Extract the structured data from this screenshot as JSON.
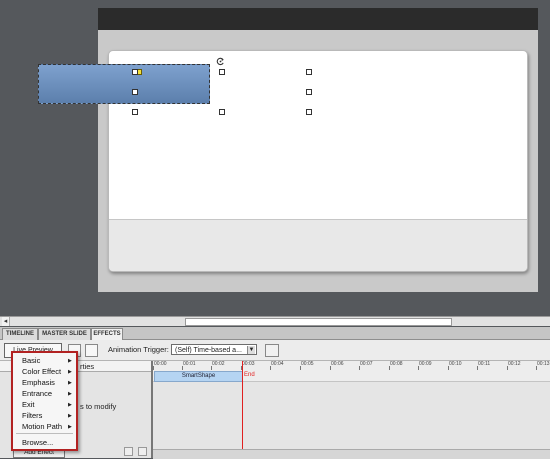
{
  "tabs": [
    {
      "label": "TIMELINE"
    },
    {
      "label": "MASTER SLIDE"
    },
    {
      "label": "EFFECTS"
    }
  ],
  "toolbar": {
    "trigger_label": "Animation Trigger:",
    "trigger_value": "(Self) Time-based a..."
  },
  "add_effect_label": "Live Preview",
  "add_effect_bottom_label": "Add Effect",
  "properties_header": "rties",
  "modify_hint": "s to modify",
  "menu": {
    "items": [
      {
        "label": "Basic",
        "submenu": true
      },
      {
        "label": "Color Effect",
        "submenu": true
      },
      {
        "label": "Emphasis",
        "submenu": true
      },
      {
        "label": "Entrance",
        "submenu": true
      },
      {
        "label": "Exit",
        "submenu": true
      },
      {
        "label": "Filters",
        "submenu": true
      },
      {
        "label": "Motion Path",
        "submenu": true
      }
    ],
    "browse_label": "Browse..."
  },
  "timeline": {
    "ticks": [
      "00:00",
      "00:01",
      "00:02",
      "00:03",
      "00:04",
      "00:05",
      "00:06",
      "00:07",
      "00:08",
      "00:09",
      "00:10",
      "00:11",
      "00:12",
      "00:13"
    ],
    "shape_label": "SmartShape",
    "end_label": "End"
  },
  "colors": {
    "accent_menu_border": "#b22222",
    "end_marker": "#e02020",
    "shape_fill": "#6f93c2"
  }
}
